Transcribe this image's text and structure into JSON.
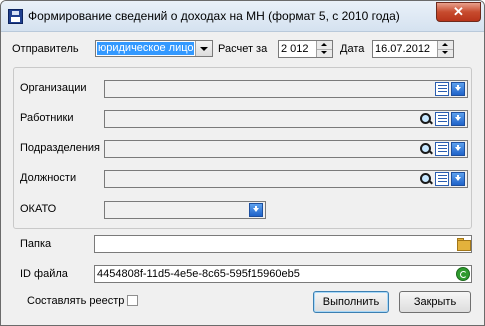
{
  "window": {
    "title": "Формирование сведений о доходах на МН (формат 5, с 2010 года)",
    "close_glyph": "✕"
  },
  "top": {
    "sender_label": "Отправитель",
    "sender_value": "юридическое лицо",
    "calc_label": "Расчет за",
    "year_value": "2 012",
    "date_label": "Дата",
    "date_value": "16.07.2012"
  },
  "filters": {
    "organizations_label": "Организации",
    "employees_label": "Работники",
    "departments_label": "Подразделения",
    "positions_label": "Должности",
    "okato_label": "ОКАТО"
  },
  "folder": {
    "label": "Папка",
    "value": ""
  },
  "file_id": {
    "label": "ID файла",
    "value": "4454808f-11d5-4e5e-8c65-595f15960eb5"
  },
  "registry": {
    "label": "Составлять реестр",
    "checked": false
  },
  "buttons": {
    "execute": "Выполнить",
    "close": "Закрыть"
  },
  "icons": {
    "search": "search-icon",
    "list": "list-icon",
    "dropdown": "dropdown-arrow-icon",
    "folder": "folder-icon",
    "refresh": "refresh-icon",
    "save": "floppy-icon"
  }
}
